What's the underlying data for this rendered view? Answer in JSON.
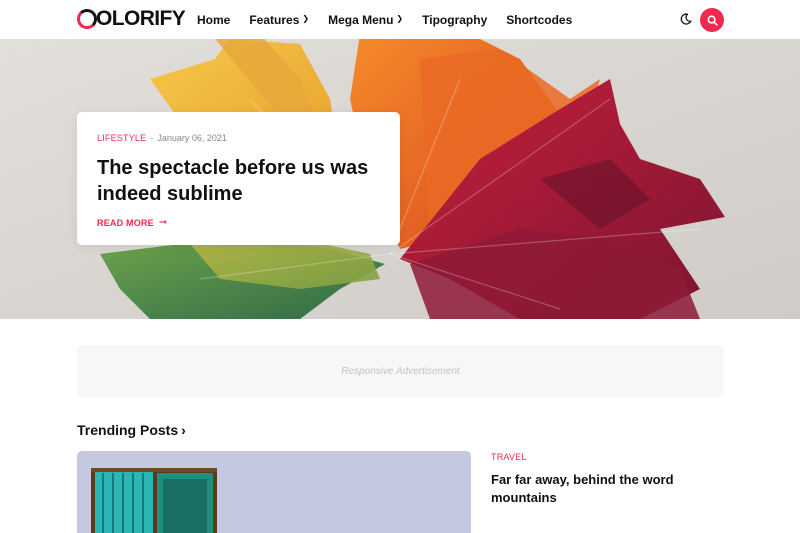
{
  "header": {
    "logo_letter": "C",
    "logo_text": "OLORIFY",
    "nav": [
      {
        "label": "Home",
        "has_caret": false
      },
      {
        "label": "Features",
        "has_caret": true
      },
      {
        "label": "Mega Menu",
        "has_caret": true
      },
      {
        "label": "Tipography",
        "has_caret": false
      },
      {
        "label": "Shortcodes",
        "has_caret": false
      }
    ],
    "icons": {
      "theme_toggle": "moon-icon",
      "search": "search-icon"
    }
  },
  "hero": {
    "category": "LIFESTYLE",
    "separator": "-",
    "date": "January 06, 2021",
    "title": "The spectacle before us was indeed sublime",
    "read_more": "READ MORE",
    "read_more_icon": "arrow-right-icon"
  },
  "ad": {
    "text": "Responsive Advertisement"
  },
  "trending": {
    "heading": "Trending Posts",
    "heading_icon": "chevron-right-icon",
    "side_post": {
      "category": "TRAVEL",
      "title": "Far far away, behind the word mountains"
    }
  },
  "colors": {
    "accent": "#f0294f",
    "text": "#111111",
    "muted": "#888888",
    "ad_bg": "#f7f7f7"
  }
}
